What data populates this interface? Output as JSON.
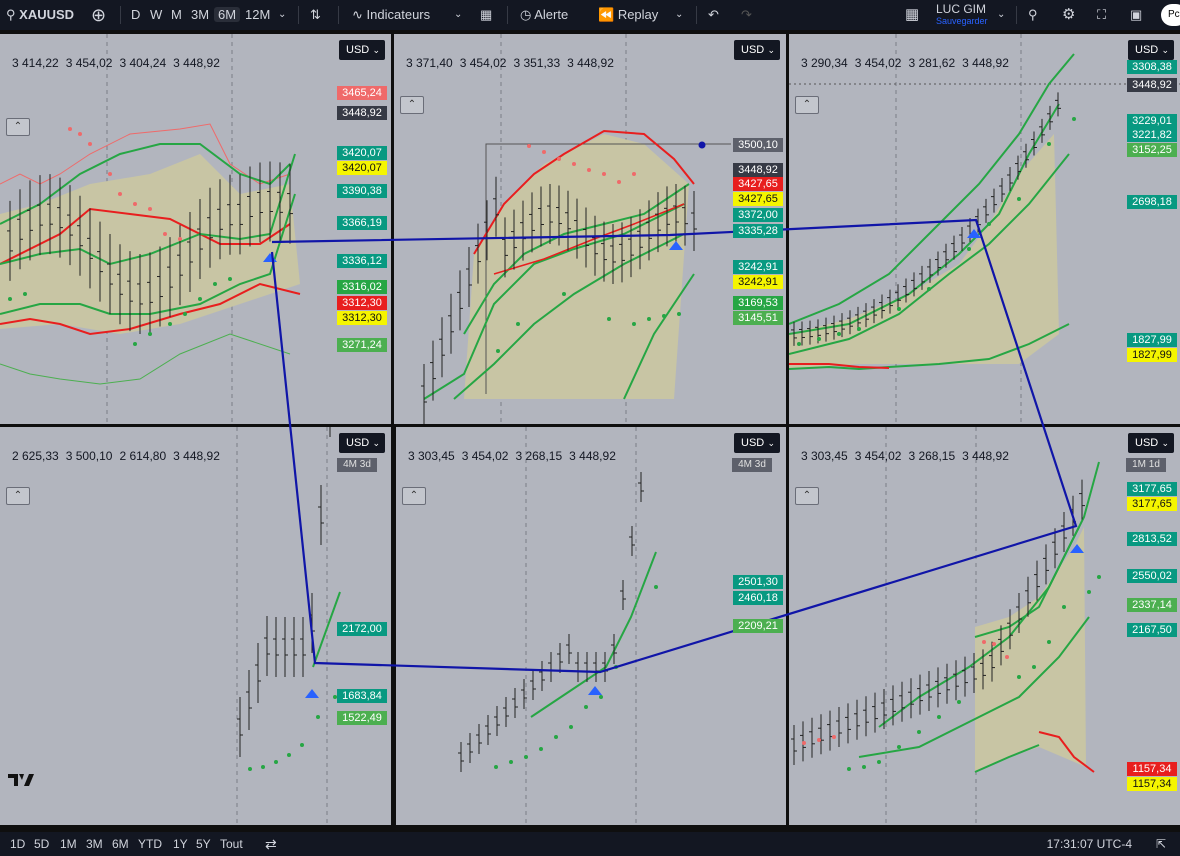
{
  "topbar": {
    "symbol": "XAUUSD",
    "timeframes": [
      "D",
      "W",
      "M",
      "3M",
      "6M",
      "12M"
    ],
    "active_timeframe": "6M",
    "indicators_label": "Indicateurs",
    "alert_label": "Alerte",
    "replay_label": "Replay",
    "layout_name": "LUC GIM",
    "layout_status": "Sauvegarder",
    "avatar_text": "Pc"
  },
  "bottombar": {
    "ranges": [
      "1D",
      "5D",
      "1M",
      "3M",
      "6M",
      "YTD",
      "1Y",
      "5Y",
      "Tout"
    ],
    "clock": "17:31:07 UTC-4"
  },
  "colors": {
    "accent_line": "#1015a8",
    "green": "#089981",
    "red": "#e81e1e",
    "yellow": "#f5f500"
  },
  "panes": [
    {
      "currency": "USD",
      "ohlc": [
        "3 414,22",
        "3 454,02",
        "3 404,24",
        "3 448,92"
      ],
      "tf_label": "",
      "tags": [
        {
          "t": "3465,24",
          "c": "pk"
        },
        {
          "t": "3448,92",
          "c": "d"
        },
        {
          "t": "3420,07",
          "c": "g"
        },
        {
          "t": "3420,07",
          "c": "y"
        },
        {
          "t": "3390,38",
          "c": "g"
        },
        {
          "t": "3366,19",
          "c": "g"
        },
        {
          "t": "3336,12",
          "c": "g"
        },
        {
          "t": "3316,02",
          "c": "g2"
        },
        {
          "t": "3312,30",
          "c": "r"
        },
        {
          "t": "3312,30",
          "c": "y"
        },
        {
          "t": "3271,24",
          "c": "lg"
        }
      ]
    },
    {
      "currency": "USD",
      "ohlc": [
        "3 371,40",
        "3 454,02",
        "3 351,33",
        "3 448,92"
      ],
      "tf_label": "",
      "tags": [
        {
          "t": "3500,10",
          "c": "gr"
        },
        {
          "t": "3448,92",
          "c": "d"
        },
        {
          "t": "3427,65",
          "c": "r"
        },
        {
          "t": "3427,65",
          "c": "y"
        },
        {
          "t": "3372,00",
          "c": "g"
        },
        {
          "t": "3335,28",
          "c": "g"
        },
        {
          "t": "3242,91",
          "c": "g"
        },
        {
          "t": "3242,91",
          "c": "y"
        },
        {
          "t": "3169,53",
          "c": "g2"
        },
        {
          "t": "3145,51",
          "c": "lg"
        }
      ]
    },
    {
      "currency": "USD",
      "ohlc": [
        "3 290,34",
        "3 454,02",
        "3 281,62",
        "3 448,92"
      ],
      "tf_label": "",
      "tags": [
        {
          "t": "3308,38",
          "c": "g"
        },
        {
          "t": "3448,92",
          "c": "d"
        },
        {
          "t": "3229,01",
          "c": "g"
        },
        {
          "t": "3221,82",
          "c": "g"
        },
        {
          "t": "3152,25",
          "c": "lg"
        },
        {
          "t": "2698,18",
          "c": "g"
        },
        {
          "t": "1827,99",
          "c": "g"
        },
        {
          "t": "1827,99",
          "c": "y"
        }
      ]
    },
    {
      "currency": "USD",
      "ohlc": [
        "2 625,33",
        "3 500,10",
        "2 614,80",
        "3 448,92"
      ],
      "tf_label": "4M 3d",
      "tags": [
        {
          "t": "2172,00",
          "c": "g"
        },
        {
          "t": "1683,84",
          "c": "g"
        },
        {
          "t": "1522,49",
          "c": "lg"
        }
      ]
    },
    {
      "currency": "USD",
      "ohlc": [
        "3 303,45",
        "3 454,02",
        "3 268,15",
        "3 448,92"
      ],
      "tf_label": "4M 3d",
      "tags": [
        {
          "t": "2501,30",
          "c": "g"
        },
        {
          "t": "2460,18",
          "c": "g"
        },
        {
          "t": "2209,21",
          "c": "lg"
        }
      ]
    },
    {
      "currency": "USD",
      "ohlc": [
        "3 303,45",
        "3 454,02",
        "3 268,15",
        "3 448,92"
      ],
      "tf_label": "1M 1d",
      "tags": [
        {
          "t": "3177,65",
          "c": "g"
        },
        {
          "t": "3177,65",
          "c": "y"
        },
        {
          "t": "2813,52",
          "c": "g"
        },
        {
          "t": "2550,02",
          "c": "g"
        },
        {
          "t": "2337,14",
          "c": "lg"
        },
        {
          "t": "2167,50",
          "c": "g"
        },
        {
          "t": "1157,34",
          "c": "r"
        },
        {
          "t": "1157,34",
          "c": "y"
        }
      ]
    }
  ]
}
